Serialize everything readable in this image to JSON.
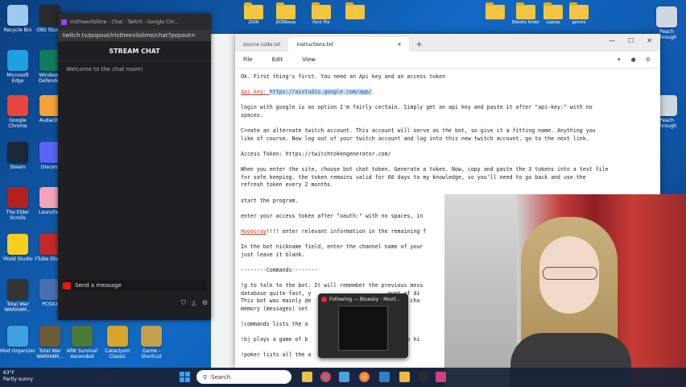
{
  "desktop": {
    "left_icons": [
      {
        "label": "Recycle Bin",
        "color": "#9ec9ef"
      },
      {
        "label": "OBS Studio",
        "color": "#2a2a2a"
      },
      {
        "label": "Microsoft Edge",
        "color": "#1fa0e0"
      },
      {
        "label": "Windows Defender",
        "color": "#0d7d5c"
      },
      {
        "label": "Google Chrome",
        "color": "#e8453c"
      },
      {
        "label": "Audacity",
        "color": "#f2a33a"
      },
      {
        "label": "Steam",
        "color": "#1b2838"
      },
      {
        "label": "Discord",
        "color": "#5865f2"
      },
      {
        "label": "The Elder Scrolls",
        "color": "#b32020"
      },
      {
        "label": "Launcher",
        "color": "#f5a2b8"
      },
      {
        "label": "YKold Studio",
        "color": "#f5d020"
      },
      {
        "label": "YTube Studio",
        "color": "#c62828"
      },
      {
        "label": "Total War WARHAM...",
        "color": "#333333"
      },
      {
        "label": "PCSX2",
        "color": "#4a6fb0"
      },
      {
        "label": "Mod Organizer",
        "color": "#3fa2e0"
      },
      {
        "label": "Total War WARHAM...",
        "color": "#6b5a3a"
      },
      {
        "label": "ARK Survival Ascended",
        "color": "#4b7a3a"
      },
      {
        "label": "Cataclysm Classic",
        "color": "#d8a42a"
      },
      {
        "label": "Game - Shortcut",
        "color": "#c0a050"
      }
    ],
    "top_folders": [
      "JSON",
      "JSONbeep",
      "Pack File",
      "",
      "",
      "Ebooks folder",
      "Laptop",
      "gemini"
    ],
    "right_icons": [
      {
        "label": "Peach Through",
        "color": "#cfd8e0"
      },
      {
        "label": "Peach Through",
        "color": "#cfd8e0"
      }
    ]
  },
  "chat_window": {
    "tab_title": "iristheevilslime - Chat - Twitch - Google Chr...",
    "url": "twitch.tv/popout/iristheevilslime/chat?popout=",
    "header": "STREAM CHAT",
    "welcome": "Welcome to the chat room!",
    "send_placeholder": "Send a message"
  },
  "notepad": {
    "tabs": [
      "source code.txt",
      "Instructions.txt"
    ],
    "active_tab": "Instructions.txt",
    "menu": [
      "File",
      "Edit",
      "View"
    ],
    "lines": {
      "p1": "Ok. First thing's first. You need an Api key and an access token",
      "p2_label": "Api key: ",
      "p2_link": "https://aistudio.google.com/app/",
      "p3": "login with google is an option I'm fairly certain. Simply get an api key and paste it after \"api-key:\" with no\nspaces.",
      "p4": "Create an alternate twitch account. This account will serve as the bot, so give it a fitting name. Anything you\nlike of course. Now log out of your twitch account and log into this new twitch account. go to the next link.",
      "p5": "Access Token: https://twitchtokengenerator.com/",
      "p6": "When you enter the site, choose bot chat token. Generate a token. Now, copy and paste the 3 tokens into a text file\nfor safe keeping. the token remains valid for 60 days to my knowledge, so you'll need to go back and use the\nrefresh token every 2 months.",
      "p7": "start the program.",
      "p8": "enter your access token after \"oauth:\" with no spaces, in",
      "p9_red": "Hooooray",
      "p9_rest": "!!!! enter relevant information in the remaining f",
      "p10": "In the bot nickname field, enter the channel name of your\njust leave it blank.",
      "p11": "--------Commands--------",
      "p12": "!g to talk to the bot. It will remember the previous mess\ndatabase quite fast, y                        ount of di\nThis bot was mainly de                        ll (my cha\nmemory (messages) set",
      "p13": "!commands lists the a",
      "p14": "!bj plays a game of b                          hit to hi",
      "p15": "!poker lists all the a"
    }
  },
  "popup": {
    "title": "Following — Bluesky - Mozil..."
  },
  "taskbar": {
    "weather_temp": "63°F",
    "weather_desc": "Partly sunny",
    "search_placeholder": "Search"
  }
}
